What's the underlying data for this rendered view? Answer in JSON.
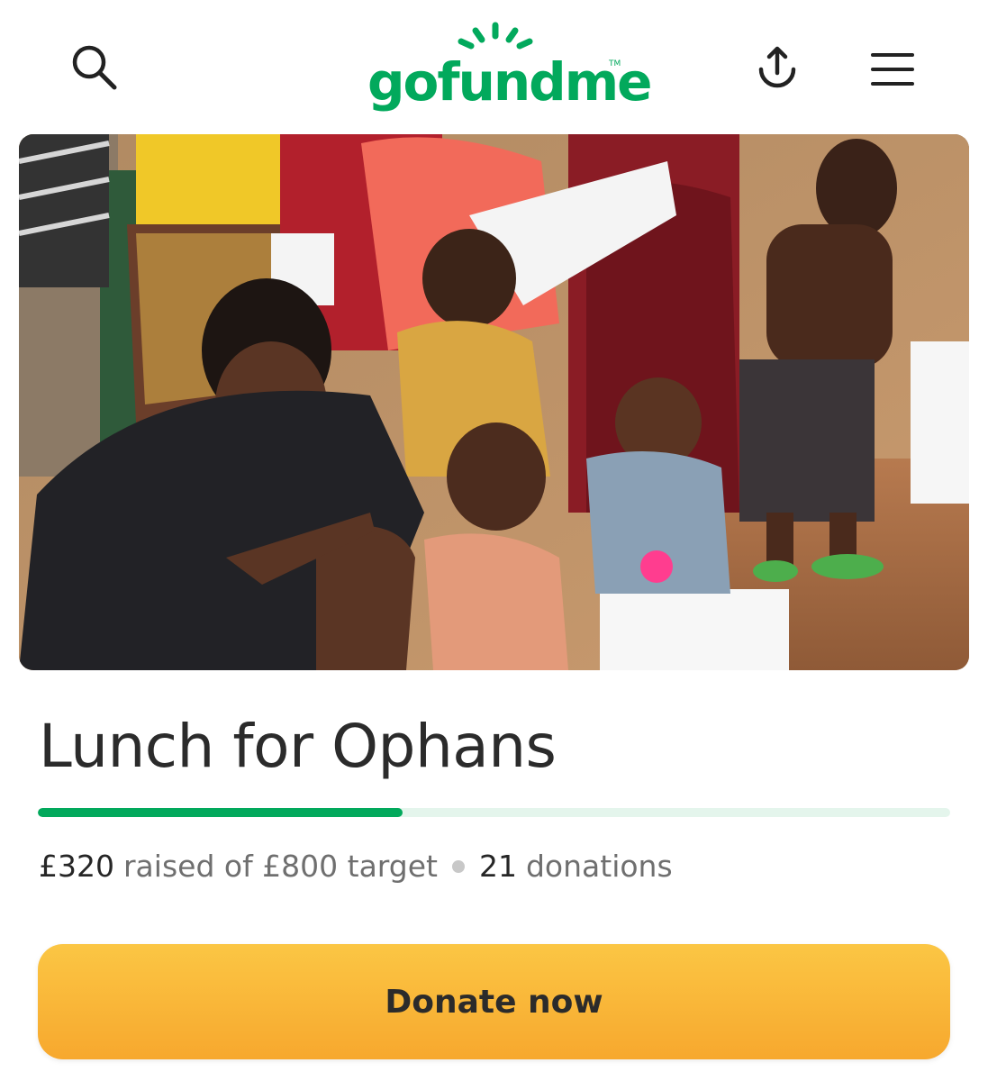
{
  "header": {
    "brand": "gofundme",
    "trademark": "TM",
    "icons": {
      "search": "search-icon",
      "share": "share-upload-icon",
      "menu": "hamburger-menu-icon"
    },
    "brand_color": "#02a95c"
  },
  "campaign": {
    "title": "Lunch for Ophans",
    "raised": "£320",
    "raised_label": "raised of £800 target",
    "donations_count": "21",
    "donations_label": "donations",
    "progress_fraction": 0.4
  },
  "actions": {
    "donate_label": "Donate now",
    "donate_color": "#f9b233"
  }
}
